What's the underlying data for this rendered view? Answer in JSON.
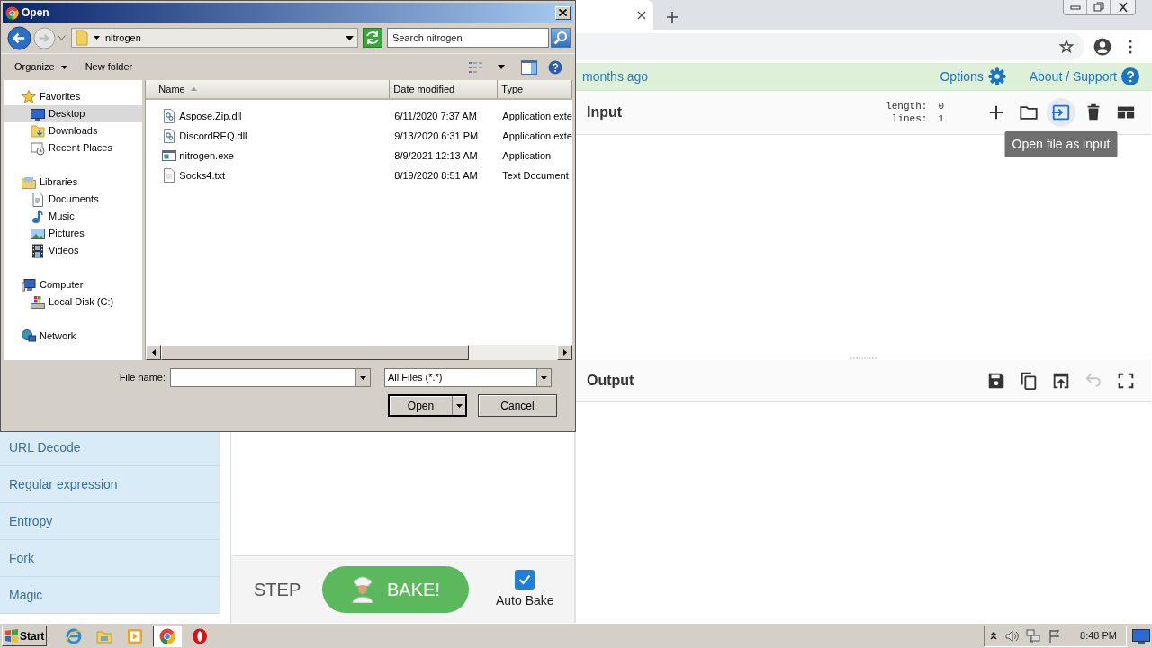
{
  "dialog": {
    "title": "Open",
    "address": "nitrogen",
    "search": {
      "placeholder": "Search nitrogen"
    },
    "commands": [
      "Organize",
      "New folder"
    ],
    "nav_pane": [
      {
        "label": "Favorites",
        "kind": "favorites",
        "selected": false,
        "children": [
          {
            "label": "Desktop",
            "kind": "desktop",
            "selected": true
          },
          {
            "label": "Downloads",
            "kind": "downloads",
            "selected": false
          },
          {
            "label": "Recent Places",
            "kind": "recent",
            "selected": false
          }
        ]
      },
      {
        "label": "Libraries",
        "kind": "libraries",
        "selected": false,
        "children": [
          {
            "label": "Documents",
            "kind": "documents",
            "selected": false
          },
          {
            "label": "Music",
            "kind": "music",
            "selected": false
          },
          {
            "label": "Pictures",
            "kind": "pictures",
            "selected": false
          },
          {
            "label": "Videos",
            "kind": "videos",
            "selected": false
          }
        ]
      },
      {
        "label": "Computer",
        "kind": "computer",
        "selected": false,
        "children": [
          {
            "label": "Local Disk (C:)",
            "kind": "disk",
            "selected": false
          }
        ]
      },
      {
        "label": "Network",
        "kind": "network",
        "selected": false
      }
    ],
    "columns": [
      {
        "label": "Name",
        "sorted": true
      },
      {
        "label": "Date modified",
        "sorted": false
      },
      {
        "label": "Type",
        "sorted": false
      }
    ],
    "files": [
      {
        "name": "Aspose.Zip.dll",
        "date": "6/11/2020 7:37 AM",
        "type": "Application exte",
        "kind": "dll"
      },
      {
        "name": "DiscordREQ.dll",
        "date": "9/13/2020 6:31 PM",
        "type": "Application exte",
        "kind": "dll"
      },
      {
        "name": "nitrogen.exe",
        "date": "8/9/2021 12:13 AM",
        "type": "Application",
        "kind": "exe"
      },
      {
        "name": "Socks4.txt",
        "date": "8/19/2020 8:51 AM",
        "type": "Text Document",
        "kind": "txt"
      }
    ],
    "file_name_label": "File name:",
    "filter": "All Files (*.*)",
    "open_button": "Open",
    "cancel_button": "Cancel"
  },
  "browser": {
    "banner": {
      "text": "months ago",
      "options": "Options",
      "about": "About / Support"
    },
    "operations": [
      "URL Decode",
      "Regular expression",
      "Entropy",
      "Fork",
      "Magic"
    ],
    "controls": {
      "step": "STEP",
      "bake": "BAKE!",
      "auto_bake": {
        "label": "Auto Bake",
        "checked": true
      }
    },
    "input": {
      "title": "Input",
      "stats": [
        {
          "label": "length:",
          "value": "0"
        },
        {
          "label": "lines:",
          "value": "1"
        }
      ],
      "tools": [
        {
          "kind": "add",
          "hovered": false
        },
        {
          "kind": "open-folder",
          "hovered": false
        },
        {
          "kind": "open-file",
          "hovered": true
        },
        {
          "kind": "clear",
          "hovered": false
        },
        {
          "kind": "layout",
          "hovered": false
        }
      ],
      "tooltip": "Open file as input"
    },
    "output": {
      "title": "Output",
      "tools": [
        {
          "kind": "save",
          "disabled": false
        },
        {
          "kind": "copy",
          "disabled": false
        },
        {
          "kind": "replace",
          "disabled": false
        },
        {
          "kind": "undo",
          "disabled": true
        },
        {
          "kind": "maximise",
          "disabled": false
        }
      ]
    }
  },
  "taskbar": {
    "start": "Start",
    "apps": [
      {
        "kind": "ie",
        "active": false
      },
      {
        "kind": "explorer",
        "active": false
      },
      {
        "kind": "media",
        "active": false
      },
      {
        "kind": "chrome",
        "active": true
      },
      {
        "kind": "opera",
        "active": false
      }
    ],
    "clock": "8:48 PM"
  }
}
